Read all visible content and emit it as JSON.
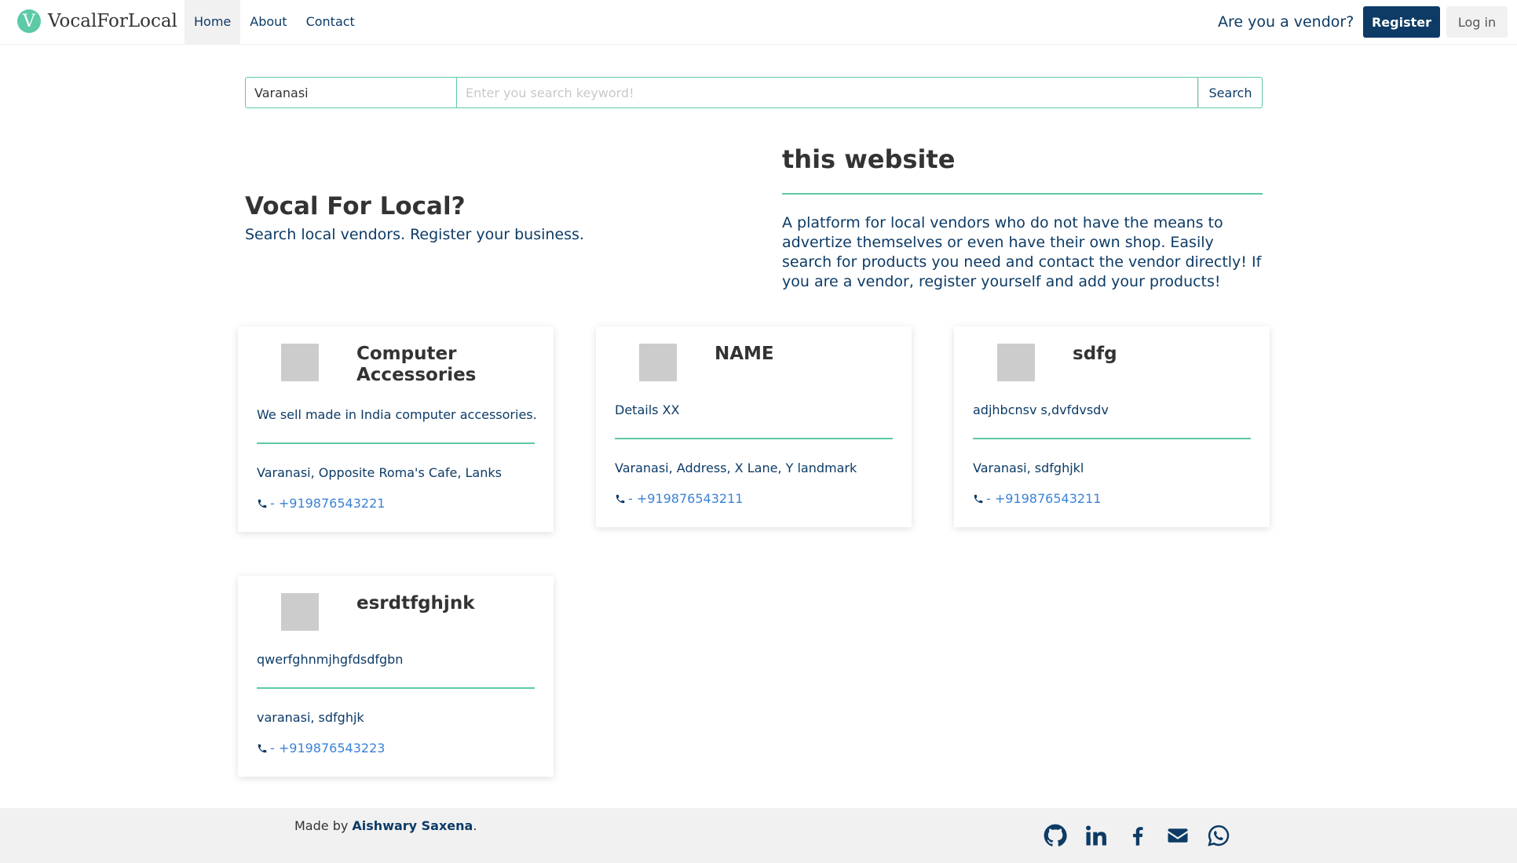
{
  "navbar": {
    "logo_letter": "V",
    "brand": "VocalForLocal",
    "links": [
      "Home",
      "About",
      "Contact"
    ],
    "vendor_question": "Are you a vendor?",
    "register_label": "Register",
    "login_label": "Log in"
  },
  "search": {
    "location_value": "Varanasi",
    "keyword_placeholder": "Enter you search keyword!",
    "button_label": "Search"
  },
  "hero": {
    "title": "Vocal For Local?",
    "subtitle": "Search local vendors. Register your business."
  },
  "about": {
    "title": "this website",
    "text": "A platform for local vendors who do not have the means to advertize themselves or even have their own shop. Easily search for products you need and contact the vendor directly! If you are a vendor, register yourself and add your products!"
  },
  "vendors": [
    {
      "name": "Computer Accessories",
      "description": "We sell made in India computer accessories.",
      "address": "Varanasi, Opposite Roma's Cafe, Lanks",
      "phone": "- +919876543221"
    },
    {
      "name": "NAME",
      "description": "Details XX",
      "address": "Varanasi, Address, X Lane, Y landmark",
      "phone": "- +919876543211"
    },
    {
      "name": "sdfg",
      "description": "adjhbcnsv s,dvfdvsdv",
      "address": "Varanasi, sdfghjkl",
      "phone": "- +919876543211"
    },
    {
      "name": "esrdtfghjnk",
      "description": "qwerfghnmjhgfdsdfgbn",
      "address": "varanasi, sdfghjk",
      "phone": "- +919876543223"
    }
  ],
  "footer": {
    "made_by_prefix": "Made by ",
    "author": "Aishwary Saxena",
    "suffix": ".",
    "social_icons": [
      "github-icon",
      "linkedin-icon",
      "facebook-icon",
      "envelope-icon",
      "whatsapp-icon"
    ]
  },
  "colors": {
    "primary": "#0d3b66",
    "accent": "#5cc9a7",
    "link": "#3b82d6"
  }
}
